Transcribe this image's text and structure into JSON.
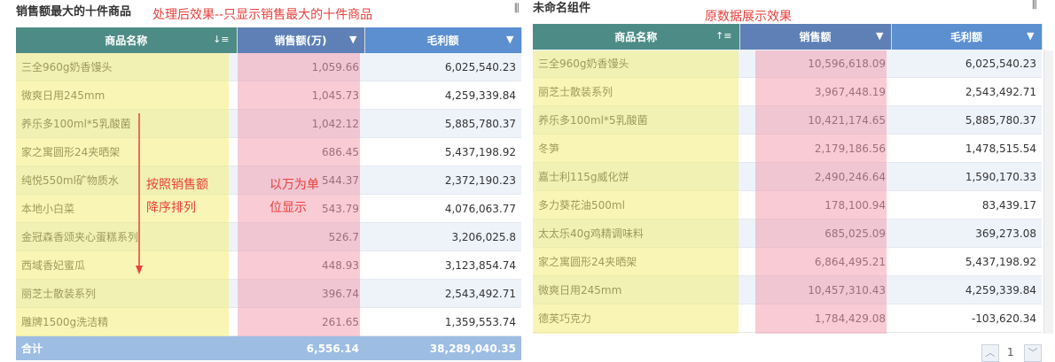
{
  "left": {
    "title": "销售额最大的十件商品",
    "menu_icon": "column-menu-icon",
    "columns": [
      {
        "label": "商品名称",
        "icon": "sort-desc-icon",
        "glyph": "↓≡"
      },
      {
        "label": "销售额(万)",
        "icon": "filter-icon",
        "glyph": "▼"
      },
      {
        "label": "毛利额",
        "icon": "dropdown-icon",
        "glyph": "▼"
      }
    ],
    "rows": [
      {
        "name": "三全960g奶香馒头",
        "sales": "1,059.66",
        "profit": "6,025,540.23"
      },
      {
        "name": "微爽日用245mm",
        "sales": "1,045.73",
        "profit": "4,259,339.84"
      },
      {
        "name": "养乐多100ml*5乳酸菌",
        "sales": "1,042.12",
        "profit": "5,885,780.37"
      },
      {
        "name": "家之寓圆形24夹晒架",
        "sales": "686.45",
        "profit": "5,437,198.92"
      },
      {
        "name": "纯悦550ml矿物质水",
        "sales": "544.37",
        "profit": "2,372,190.23"
      },
      {
        "name": "本地小白菜",
        "sales": "543.79",
        "profit": "4,076,063.77"
      },
      {
        "name": "金冠森香颂夹心蛋糕系列",
        "sales": "526.7",
        "profit": "3,206,025.8"
      },
      {
        "name": "西域香妃蜜瓜",
        "sales": "448.93",
        "profit": "3,123,854.74"
      },
      {
        "name": "丽芝士散装系列",
        "sales": "396.74",
        "profit": "2,543,492.71"
      },
      {
        "name": "雕牌1500g洗洁精",
        "sales": "261.65",
        "profit": "1,359,553.74"
      }
    ],
    "total": {
      "label": "合计",
      "sales": "6,556.14",
      "profit": "38,289,040.35"
    }
  },
  "right": {
    "title": "未命名组件",
    "menu_icon": "column-menu-icon",
    "columns": [
      {
        "label": "商品名称",
        "icon": "sort-asc-icon",
        "glyph": "↑≡"
      },
      {
        "label": "销售额",
        "icon": "dropdown-icon",
        "glyph": "▼"
      },
      {
        "label": "毛利额",
        "icon": "dropdown-icon",
        "glyph": "▼"
      }
    ],
    "rows": [
      {
        "name": "三全960g奶香馒头",
        "sales": "10,596,618.09",
        "profit": "6,025,540.23"
      },
      {
        "name": "丽芝士散装系列",
        "sales": "3,967,448.19",
        "profit": "2,543,492.71"
      },
      {
        "name": "养乐多100ml*5乳酸菌",
        "sales": "10,421,174.65",
        "profit": "5,885,780.37"
      },
      {
        "name": "冬笋",
        "sales": "2,179,186.56",
        "profit": "1,478,515.54"
      },
      {
        "name": "嘉士利115g威化饼",
        "sales": "2,490,246.64",
        "profit": "1,590,170.33"
      },
      {
        "name": "多力葵花油500ml",
        "sales": "178,100.94",
        "profit": "83,439.17"
      },
      {
        "name": "太太乐40g鸡精调味料",
        "sales": "685,025.09",
        "profit": "369,273.08"
      },
      {
        "name": "家之寓圆形24夹晒架",
        "sales": "6,864,495.21",
        "profit": "5,437,198.92"
      },
      {
        "name": "微爽日用245mm",
        "sales": "10,457,310.43",
        "profit": "4,259,339.84"
      },
      {
        "name": "德芙巧克力",
        "sales": "1,784,429.08",
        "profit": "-103,620.34"
      }
    ],
    "pagination": {
      "page": "1",
      "prev_icon": "chevron-up-icon",
      "next_icon": "chevron-down-icon"
    }
  },
  "annotations": {
    "top_left": "处理后效果--只显示销售最大的十件商品",
    "sort_note_line1": "按照销售额",
    "sort_note_line2": "降序排列",
    "unit_note_line1": "以万为单",
    "unit_note_line2": "位显示",
    "top_right": "原数据展示效果"
  },
  "colors": {
    "header_name": "#4d8c86",
    "header_sales": "#5e80b6",
    "header_profit": "#5b8fd0",
    "total_row": "#9dbde3",
    "highlight_yellow": "#f4f19a",
    "highlight_pink": "#f7b8c4",
    "annotation_red": "#e8413c"
  }
}
